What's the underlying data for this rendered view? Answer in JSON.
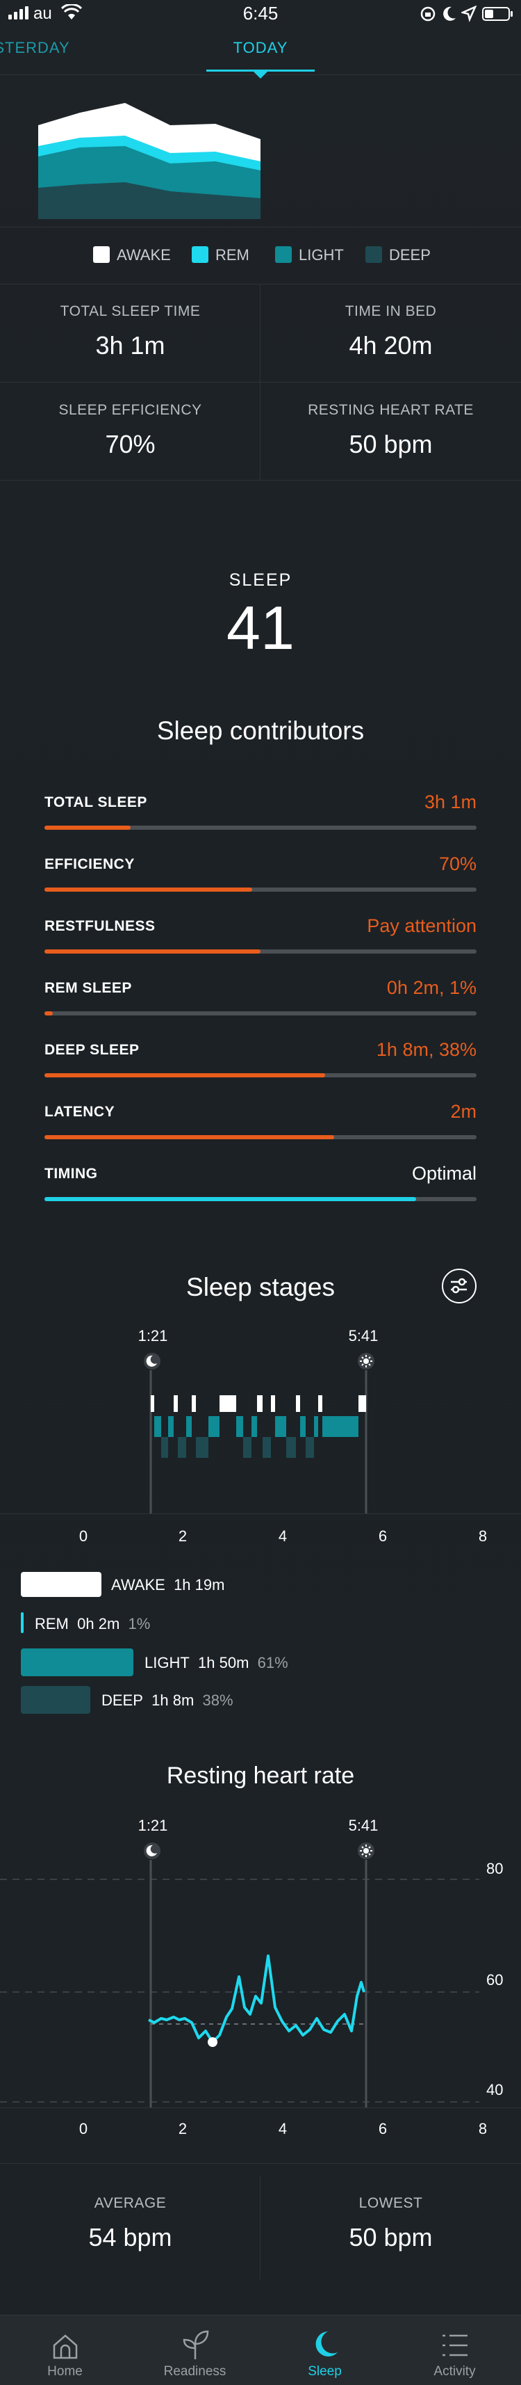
{
  "status_bar": {
    "carrier": "au",
    "time": "6:45"
  },
  "tabs": [
    {
      "label": "YESTERDAY"
    },
    {
      "label": "TODAY"
    }
  ],
  "legend_top": [
    "AWAKE",
    "REM",
    "LIGHT",
    "DEEP"
  ],
  "stats": {
    "total_sleep_time": {
      "label": "TOTAL SLEEP TIME",
      "value": "3h 1m"
    },
    "time_in_bed": {
      "label": "TIME IN BED",
      "value": "4h 20m"
    },
    "sleep_efficiency": {
      "label": "SLEEP EFFICIENCY",
      "value": "70%"
    },
    "resting_heart_rate": {
      "label": "RESTING HEART RATE",
      "value": "50 bpm"
    }
  },
  "score": {
    "label": "SLEEP",
    "value": "41"
  },
  "contributors": {
    "title": "Sleep contributors",
    "items": [
      {
        "label": "TOTAL SLEEP",
        "value": "3h 1m",
        "level": 0.2,
        "color": "#e85d1c"
      },
      {
        "label": "EFFICIENCY",
        "value": "70%",
        "level": 0.48,
        "color": "#e85d1c"
      },
      {
        "label": "RESTFULNESS",
        "value": "Pay attention",
        "level": 0.5,
        "color": "#e85d1c"
      },
      {
        "label": "REM SLEEP",
        "value": "0h 2m, 1%",
        "level": 0.02,
        "color": "#e85d1c"
      },
      {
        "label": "DEEP SLEEP",
        "value": "1h 8m, 38%",
        "level": 0.65,
        "color": "#e85d1c"
      },
      {
        "label": "LATENCY",
        "value": "2m",
        "level": 0.67,
        "color": "#e85d1c"
      },
      {
        "label": "TIMING",
        "value": "Optimal",
        "level": 0.86,
        "color": "#1fd0e6"
      }
    ]
  },
  "stages": {
    "title": "Sleep stages",
    "start": "1:21",
    "end": "5:41",
    "x_ticks": [
      "0",
      "2",
      "4",
      "6",
      "8"
    ],
    "legend": [
      {
        "name": "AWAKE",
        "duration": "1h 19m",
        "pct": ""
      },
      {
        "name": "REM",
        "duration": "0h 2m",
        "pct": "1%"
      },
      {
        "name": "LIGHT",
        "duration": "1h 50m",
        "pct": "61%"
      },
      {
        "name": "DEEP",
        "duration": "1h 8m",
        "pct": "38%"
      }
    ]
  },
  "heart_rate": {
    "title": "Resting heart rate",
    "start": "1:21",
    "end": "5:41",
    "y_ticks": [
      "80",
      "60",
      "40"
    ],
    "x_ticks": [
      "0",
      "2",
      "4",
      "6",
      "8"
    ],
    "average": {
      "label": "AVERAGE",
      "value": "54 bpm"
    },
    "lowest": {
      "label": "LOWEST",
      "value": "50 bpm"
    }
  },
  "nav": [
    {
      "label": "Home"
    },
    {
      "label": "Readiness"
    },
    {
      "label": "Sleep"
    },
    {
      "label": "Activity"
    }
  ],
  "colors": {
    "awake": "#ffffff",
    "rem": "#1fd9ee",
    "light": "#0f8c96",
    "deep": "#1f4a52",
    "accent": "#1fd0e6",
    "warning": "#e85d1c"
  }
}
